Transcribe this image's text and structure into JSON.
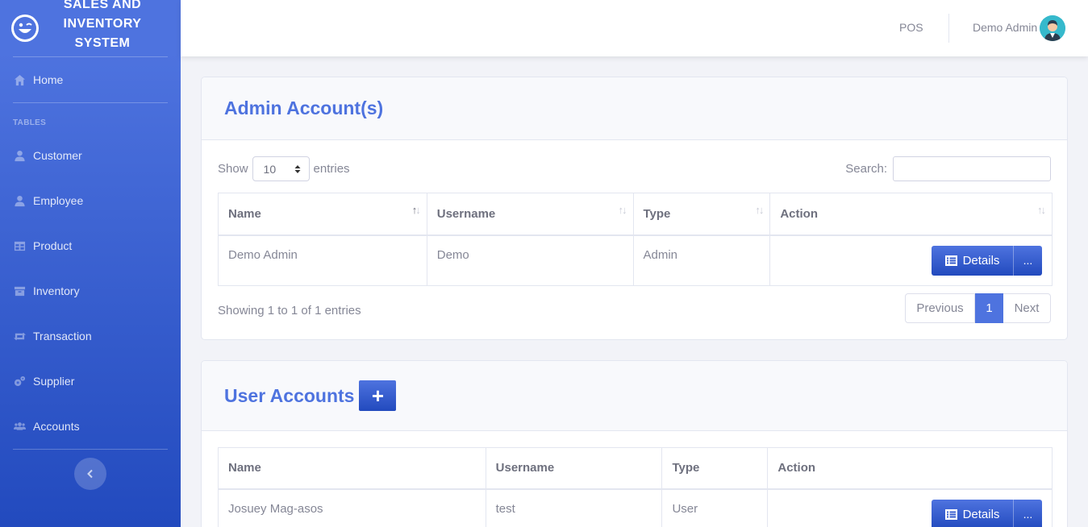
{
  "brand": {
    "title": "SALES AND\nINVENTORY\nSYSTEM"
  },
  "sidebar": {
    "home": "Home",
    "heading": "TABLES",
    "items": [
      {
        "label": "Customer",
        "icon": "user-icon"
      },
      {
        "label": "Employee",
        "icon": "user-icon"
      },
      {
        "label": "Product",
        "icon": "table-icon"
      },
      {
        "label": "Inventory",
        "icon": "archive-icon"
      },
      {
        "label": "Transaction",
        "icon": "retweet-icon"
      },
      {
        "label": "Supplier",
        "icon": "cogs-icon"
      },
      {
        "label": "Accounts",
        "icon": "users-icon"
      }
    ]
  },
  "topbar": {
    "pos": "POS",
    "user": "Demo Admin"
  },
  "admin_card": {
    "title": "Admin Account(s)",
    "show_label": "Show",
    "entries_value": "10",
    "entries_label": "entries",
    "search_label": "Search:",
    "columns": [
      "Name",
      "Username",
      "Type",
      "Action"
    ],
    "rows": [
      {
        "name": "Demo Admin",
        "username": "Demo",
        "type": "Admin"
      }
    ],
    "details_label": "Details",
    "more_label": "...",
    "info": "Showing 1 to 1 of 1 entries",
    "prev": "Previous",
    "page": "1",
    "next": "Next"
  },
  "user_card": {
    "title": "User Accounts",
    "add_label": "+",
    "columns": [
      "Name",
      "Username",
      "Type",
      "Action"
    ],
    "rows": [
      {
        "name": "Josuey Mag-asos",
        "username": "test",
        "type": "User"
      }
    ],
    "details_label": "Details",
    "more_label": "..."
  }
}
